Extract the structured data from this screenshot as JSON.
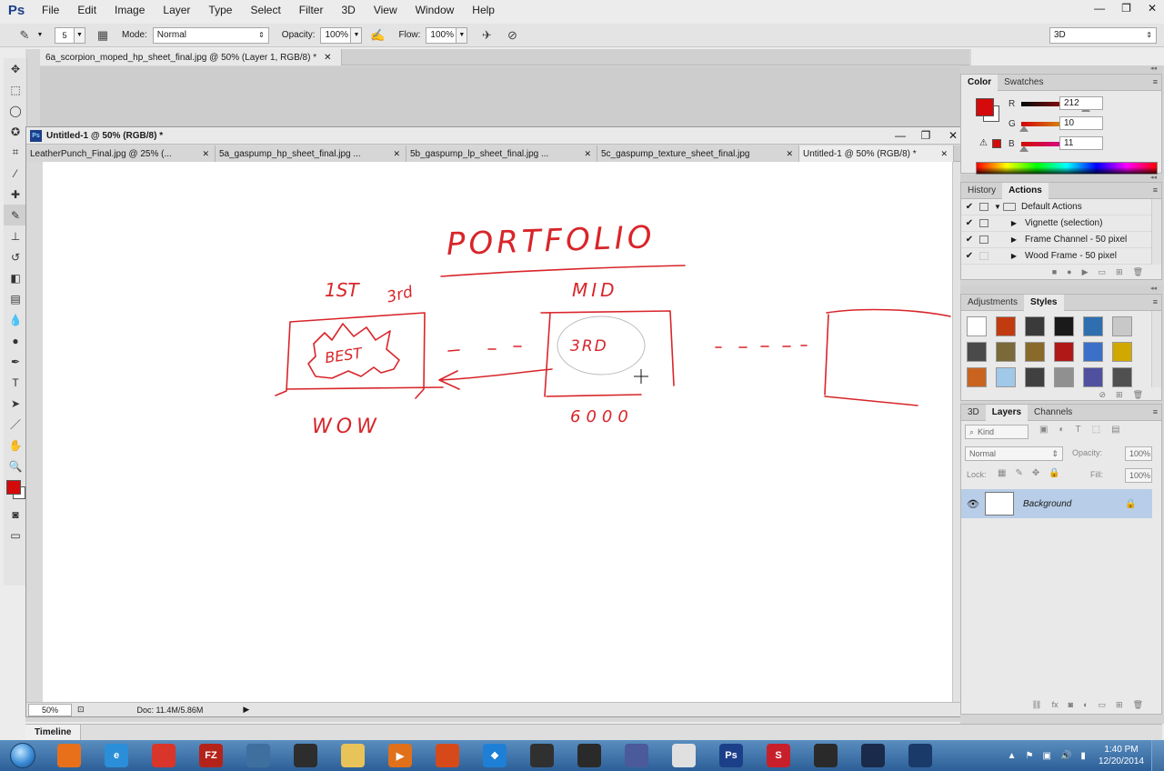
{
  "app": {
    "logo": "Ps",
    "menu": [
      "File",
      "Edit",
      "Image",
      "Layer",
      "Type",
      "Select",
      "Filter",
      "3D",
      "View",
      "Window",
      "Help"
    ],
    "window_controls": [
      "—",
      "❐",
      "✕"
    ]
  },
  "options": {
    "brush_size": "5",
    "mode_label": "Mode:",
    "mode_value": "Normal",
    "opacity_label": "Opacity:",
    "opacity_value": "100%",
    "flow_label": "Flow:",
    "flow_value": "100%",
    "workspace": "3D"
  },
  "background_doc": {
    "tab_title": "6a_scorpion_moped_hp_sheet_final.jpg @ 50% (Layer 1, RGB/8) *"
  },
  "doc_window": {
    "title": "Untitled-1 @ 50% (RGB/8) *",
    "tabs": [
      {
        "label": "LeatherPunch_Final.jpg @ 25% (...",
        "active": false
      },
      {
        "label": "5a_gaspump_hp_sheet_final.jpg ...",
        "active": false
      },
      {
        "label": "5b_gaspump_lp_sheet_final.jpg ...",
        "active": false
      },
      {
        "label": "5c_gaspump_texture_sheet_final.jpg",
        "active": false
      },
      {
        "label": "Untitled-1 @ 50% (RGB/8) *",
        "active": true
      }
    ],
    "zoom": "50%",
    "doc_info": "Doc: 11.4M/5.86M"
  },
  "sketch": {
    "title": "PORTFOLIO",
    "label_first": "1ST",
    "label_3rd": "3rd",
    "label_mid": "MID",
    "label_best": "BEST",
    "label_3rd_best": "3RD",
    "label_wow": "WOW",
    "label_6000": "6000"
  },
  "color_panel": {
    "tabs": [
      "Color",
      "Swatches"
    ],
    "fg_color": "#d40a0b",
    "r_label": "R",
    "r_value": "212",
    "g_label": "G",
    "g_value": "10",
    "b_label": "B",
    "b_value": "11"
  },
  "actions_panel": {
    "tabs": [
      "History",
      "Actions"
    ],
    "rows": [
      {
        "label": "Default Actions"
      },
      {
        "label": "Vignette (selection)"
      },
      {
        "label": "Frame Channel - 50 pixel"
      },
      {
        "label": "Wood Frame - 50 pixel"
      }
    ]
  },
  "styles_panel": {
    "tabs": [
      "Adjustments",
      "Styles"
    ],
    "swatch_colors": [
      "#ffffff",
      "#c23a10",
      "#3a3a3a",
      "#1a1a1a",
      "#2f6fb0",
      "#c8c8c8",
      "#4a4a4a",
      "#7a6a3a",
      "#8a6a2a",
      "#b01818",
      "#3a70c8",
      "#d0a800",
      "#c86420",
      "#a0c8e8",
      "#404040",
      "#909090",
      "#5050a0",
      "#505050"
    ]
  },
  "layers_panel": {
    "tabs": [
      "3D",
      "Layers",
      "Channels"
    ],
    "kind": "Kind",
    "blend": "Normal",
    "opacity_label": "Opacity:",
    "opacity_value": "100%",
    "lock_label": "Lock:",
    "fill_label": "Fill:",
    "fill_value": "100%",
    "layer_name": "Background"
  },
  "timeline": {
    "label": "Timeline"
  },
  "taskbar": {
    "apps": [
      {
        "icon": "firefox-icon",
        "color": "#e8701a",
        "text": ""
      },
      {
        "icon": "ie-icon",
        "color": "#2a8fd8",
        "text": "e"
      },
      {
        "icon": "chrome-icon",
        "color": "#d9352a",
        "text": ""
      },
      {
        "icon": "filezilla-icon",
        "color": "#b4231a",
        "text": "FZ"
      },
      {
        "icon": "app-icon",
        "color": "#3e6f9e",
        "text": ""
      },
      {
        "icon": "app-icon",
        "color": "#2d2d2d",
        "text": ""
      },
      {
        "icon": "explorer-icon",
        "color": "#e8c35a",
        "text": ""
      },
      {
        "icon": "media-icon",
        "color": "#e0701a",
        "text": "▶"
      },
      {
        "icon": "app-icon",
        "color": "#d64a1a",
        "text": ""
      },
      {
        "icon": "dropbox-icon",
        "color": "#1e7fd6",
        "text": "❖"
      },
      {
        "icon": "zbrush-icon",
        "color": "#303030",
        "text": ""
      },
      {
        "icon": "app-icon",
        "color": "#2a2a2a",
        "text": ""
      },
      {
        "icon": "app-icon",
        "color": "#4a5a9a",
        "text": ""
      },
      {
        "icon": "app-icon",
        "color": "#e0e0e0",
        "text": ""
      },
      {
        "icon": "photoshop-icon",
        "color": "#1c3f8a",
        "text": "Ps"
      },
      {
        "icon": "app-icon",
        "color": "#c8202a",
        "text": "S"
      },
      {
        "icon": "app-icon",
        "color": "#2a2a2a",
        "text": ""
      },
      {
        "icon": "app-icon",
        "color": "#1a2a4a",
        "text": ""
      },
      {
        "icon": "app-icon",
        "color": "#1a3a6a",
        "text": ""
      }
    ],
    "time": "1:40 PM",
    "date": "12/20/2014"
  }
}
